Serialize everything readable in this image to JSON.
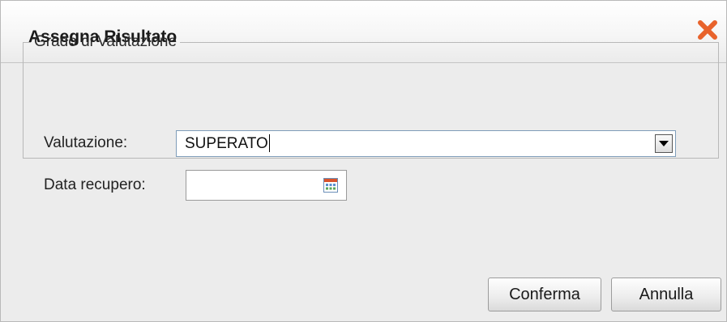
{
  "dialog": {
    "title": "Assegna Risultato",
    "close_icon": "close-x-icon",
    "close_color": "#e8632c"
  },
  "group": {
    "legend": "Grado di Valutazione",
    "valutazione": {
      "label": "Valutazione:",
      "value": "SUPERATO",
      "dropdown_icon": "chevron-down-icon"
    },
    "data_recupero": {
      "label": "Data recupero:",
      "value": "",
      "calendar_icon": "calendar-icon"
    }
  },
  "buttons": {
    "confirm": "Conferma",
    "cancel": "Annulla"
  }
}
